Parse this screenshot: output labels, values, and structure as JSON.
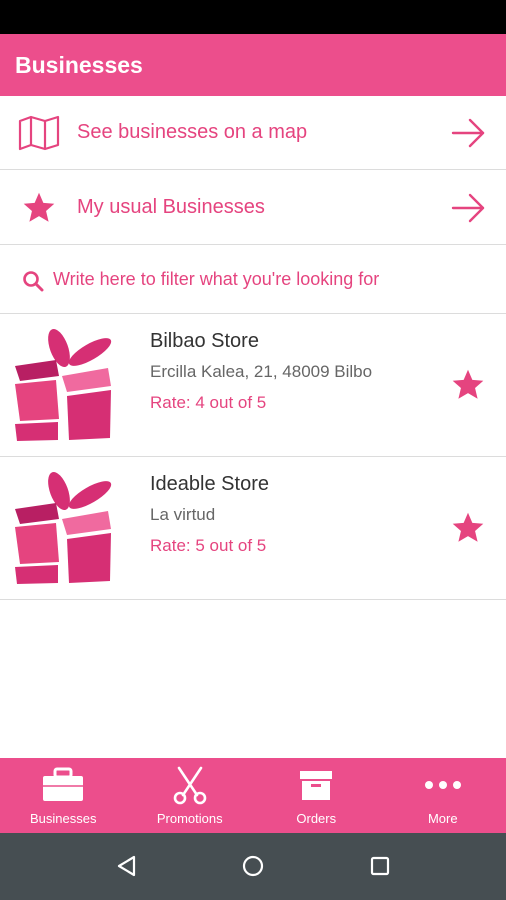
{
  "colors": {
    "accent": "#ec4e8c",
    "accent_text": "#e5447f",
    "gift_dark": "#b81f63",
    "gift_mid": "#d62f74",
    "gift_light": "#f06a9f",
    "system_nav": "#464e52"
  },
  "header": {
    "title": "Businesses"
  },
  "links": [
    {
      "label": "See businesses on a map",
      "icon": "map-icon"
    },
    {
      "label": "My usual Businesses",
      "icon": "star-icon"
    }
  ],
  "search": {
    "placeholder": "Write here to filter what you're looking for"
  },
  "businesses": [
    {
      "name": "Bilbao Store",
      "address": "Ercilla Kalea, 21, 48009 Bilbo",
      "rate": "Rate: 4 out of 5"
    },
    {
      "name": "Ideable Store",
      "address": "La virtud",
      "rate": "Rate: 5 out of 5"
    }
  ],
  "bottom_nav": [
    {
      "label": "Businesses",
      "icon": "briefcase-icon"
    },
    {
      "label": "Promotions",
      "icon": "scissors-icon"
    },
    {
      "label": "Orders",
      "icon": "archive-box-icon"
    },
    {
      "label": "More",
      "icon": "more-dots-icon"
    }
  ]
}
